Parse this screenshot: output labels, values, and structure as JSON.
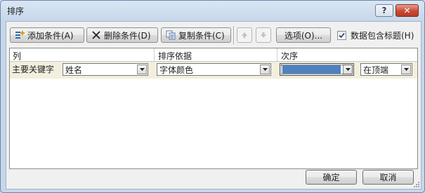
{
  "window": {
    "title": "排序"
  },
  "titlebar": {
    "help_label": "?",
    "close_label": "✕"
  },
  "toolbar": {
    "add_label": "添加条件(A)",
    "delete_label": "删除条件(D)",
    "copy_label": "复制条件(C)",
    "options_label": "选项(O)...",
    "header_checkbox_label": "数据包含标题(H)",
    "header_checkbox_checked": true
  },
  "grid": {
    "headers": {
      "column": "列",
      "sort_on": "排序依据",
      "order": "次序"
    },
    "rows": [
      {
        "label": "主要关键字",
        "column_value": "姓名",
        "sort_on_value": "字体颜色",
        "color_value": "#4f81bd",
        "position_value": "在顶端"
      }
    ]
  },
  "footer": {
    "ok_label": "确定",
    "cancel_label": "取消"
  },
  "icons": {
    "add": "add-condition-icon",
    "delete": "delete-x-icon",
    "copy": "copy-icon",
    "up": "move-up-icon",
    "down": "move-down-icon"
  }
}
